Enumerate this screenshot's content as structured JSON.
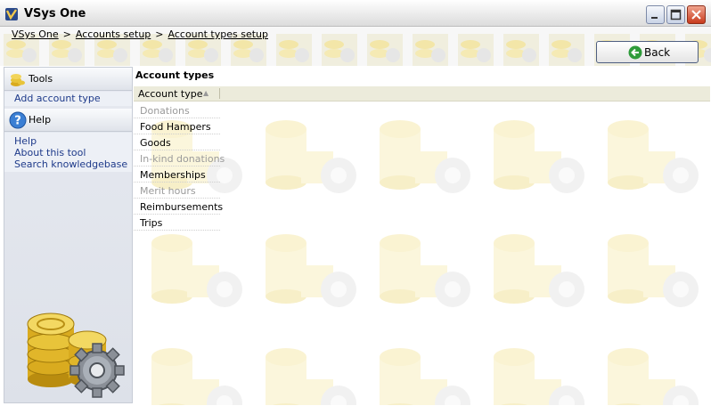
{
  "window": {
    "title": "VSys One"
  },
  "breadcrumb": [
    {
      "label": "VSys One"
    },
    {
      "label": "Accounts setup"
    },
    {
      "label": "Account types setup"
    }
  ],
  "breadcrumb_sep": ">",
  "back_button": {
    "label": "Back"
  },
  "sidebar": {
    "tools": {
      "title": "Tools",
      "items": [
        {
          "label": "Add account type"
        }
      ]
    },
    "help": {
      "title": "Help",
      "items": [
        {
          "label": "Help"
        },
        {
          "label": "About this tool"
        },
        {
          "label": "Search knowledgebase"
        }
      ]
    }
  },
  "main": {
    "title": "Account types",
    "column_header": "Account type",
    "rows": [
      {
        "label": "Donations",
        "enabled": false
      },
      {
        "label": "Food Hampers",
        "enabled": true
      },
      {
        "label": "Goods",
        "enabled": true
      },
      {
        "label": "In-kind donations",
        "enabled": false
      },
      {
        "label": "Memberships",
        "enabled": true
      },
      {
        "label": "Merit hours",
        "enabled": false
      },
      {
        "label": "Reimbursements",
        "enabled": true
      },
      {
        "label": "Trips",
        "enabled": true
      }
    ]
  },
  "colors": {
    "link": "#1e3a8a",
    "dim_text": "#9a9a9a",
    "header_bg": "#ecebdb",
    "coin": "#e8c43a"
  }
}
